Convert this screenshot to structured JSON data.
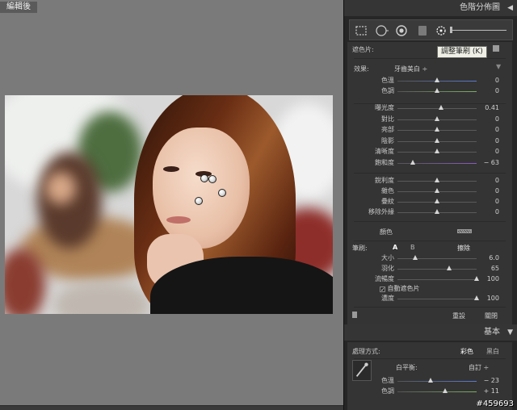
{
  "left": {
    "view_label": "編輯後"
  },
  "panel_header": {
    "title": "色階分佈圖"
  },
  "tooltip": "調整筆刷 (K)",
  "mask": {
    "title": "遮色片:",
    "effect_label": "效果:",
    "effect_value": "牙齒美白 ÷",
    "rows_top": [
      {
        "label": "色溫",
        "value": "0",
        "pos": 0.5,
        "color": "#5a7ad0"
      },
      {
        "label": "色調",
        "value": "0",
        "pos": 0.5,
        "color": "#7ab060"
      }
    ],
    "rows_tone": [
      {
        "label": "曝光度",
        "value": "0.41",
        "pos": 0.55
      },
      {
        "label": "對比",
        "value": "0",
        "pos": 0.5
      },
      {
        "label": "亮部",
        "value": "0",
        "pos": 0.5
      },
      {
        "label": "陰影",
        "value": "0",
        "pos": 0.5
      },
      {
        "label": "清晰度",
        "value": "0",
        "pos": 0.5
      },
      {
        "label": "飽和度",
        "value": "− 63",
        "pos": 0.19,
        "color": "#8a5ac0"
      }
    ],
    "rows_detail": [
      {
        "label": "銳利度",
        "value": "0",
        "pos": 0.5
      },
      {
        "label": "雜色",
        "value": "0",
        "pos": 0.5
      },
      {
        "label": "疊紋",
        "value": "0",
        "pos": 0.5
      },
      {
        "label": "移除外緣",
        "value": "0",
        "pos": 0.5
      }
    ],
    "color_label": "顏色",
    "brush": {
      "label": "筆刷:",
      "tab_a": "A",
      "tab_b": "B",
      "erase": "擦除",
      "rows": [
        {
          "label": "大小",
          "value": "6.0",
          "pos": 0.22
        },
        {
          "label": "羽化",
          "value": "65",
          "pos": 0.65
        },
        {
          "label": "流暢度",
          "value": "100",
          "pos": 1.0
        }
      ],
      "auto_mask_label": "自動遮色片",
      "auto_mask_checked": "✓",
      "density": {
        "label": "濃度",
        "value": "100",
        "pos": 1.0
      }
    },
    "reset": "重設",
    "close": "關閉"
  },
  "basic": {
    "header": "基本",
    "treatment_label": "處理方式:",
    "color_mode": "彩色",
    "bw_mode": "黑白",
    "wb_label": "白平衡:",
    "wb_value": "自訂 ÷",
    "rows": [
      {
        "label": "色溫",
        "value": "− 23",
        "pos": 0.42,
        "color": "#5a7ad0"
      },
      {
        "label": "色調",
        "value": "+ 11",
        "pos": 0.6,
        "color": "#7ab060"
      }
    ]
  },
  "stamp": "#459693"
}
